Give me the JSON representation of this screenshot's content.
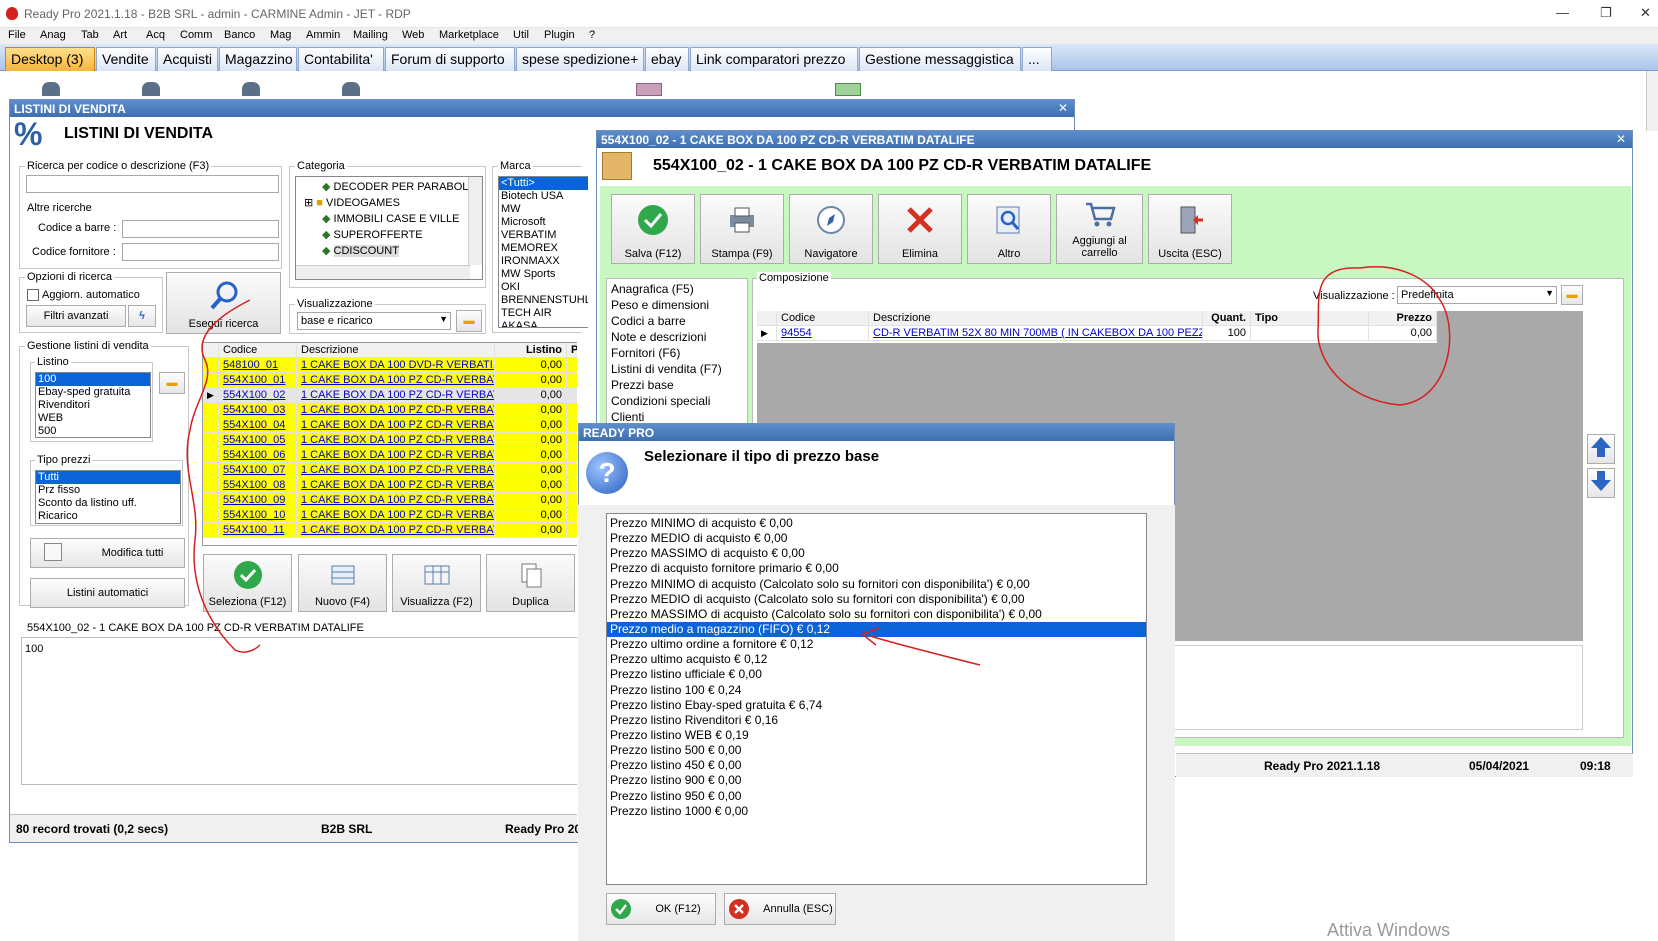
{
  "app": {
    "title": "Ready Pro 2021.1.18 - B2B SRL - admin - CARMINE Admin - JET - RDP",
    "window_controls": [
      "—",
      "❐",
      "✕"
    ]
  },
  "menu": [
    "File",
    "Anag",
    "Tab",
    "Art",
    "Acq",
    "Comm",
    "Banco",
    "Mag",
    "Ammin",
    "Mailing",
    "Web",
    "Marketplace",
    "Util",
    "Plugin",
    "?"
  ],
  "tabs": [
    "Desktop (3)",
    "Vendite",
    "Acquisti",
    "Magazzino",
    "Contabilita'",
    "Forum di supporto",
    "spese spedizione+",
    "ebay",
    "Link comparatori prezzo",
    "Gestione messaggistica",
    "..."
  ],
  "listini": {
    "window_title": "LISTINI DI VENDITA",
    "heading": "LISTINI DI VENDITA",
    "pct_icon": "%",
    "search_label": "Ricerca per codice o descrizione (F3)",
    "search_value": "",
    "altre_label": "Altre ricerche",
    "barcode_label": "Codice a barre :",
    "supplier_code_label": "Codice fornitore :",
    "options_label": "Opzioni di ricerca",
    "auto_update_label": "Aggiorn. automatico",
    "advanced_filters_label": "Filtri avanzati",
    "run_search_label": "Esegui ricerca",
    "category_label": "Categoria",
    "categories": [
      "DECODER PER PARABOLA",
      "VIDEOGAMES",
      "IMMOBILI CASE E VILLE",
      "SUPEROFFERTE",
      "CDISCOUNT"
    ],
    "brand_label": "Marca",
    "brands": [
      "<Tutti>",
      "Biotech USA",
      "MW",
      "Microsoft",
      "VERBATIM",
      "MEMOREX",
      "IRONMAXX",
      "MW Sports",
      "OKI",
      "BRENNENSTUHL",
      "TECH AIR",
      "AKASA"
    ],
    "view_label": "Visualizzazione",
    "view_value": "base e ricarico",
    "gestione_label": "Gestione listini di vendita",
    "listino_label": "Listino",
    "listini": [
      "100",
      "Ebay-sped gratuita",
      "Rivenditori",
      "WEB",
      "500"
    ],
    "tipo_prezzi_label": "Tipo prezzi",
    "tipo_prezzi": [
      "Tutti",
      "Prz fisso",
      "Sconto da listino uff.",
      "Ricarico"
    ],
    "modify_all_label": "Modifica tutti",
    "auto_lists_label": "Listini automatici",
    "grid_headers": [
      "Codice",
      "Descrizione",
      "Listino",
      "P"
    ],
    "rows": [
      {
        "code": "548100_01",
        "desc": "1 CAKE BOX DA 100 DVD-R VERBATI...",
        "price": "0,00"
      },
      {
        "code": "554X100_01",
        "desc": "1 CAKE BOX DA 100 PZ CD-R VERBAT...",
        "price": "0,00"
      },
      {
        "code": "554X100_02",
        "desc": "1 CAKE BOX DA 100 PZ CD-R VERBAT...",
        "price": "0,00"
      },
      {
        "code": "554X100_03",
        "desc": "1 CAKE BOX DA 100 PZ CD-R VERBAT...",
        "price": "0,00"
      },
      {
        "code": "554X100_04",
        "desc": "1 CAKE BOX DA 100 PZ CD-R VERBAT...",
        "price": "0,00"
      },
      {
        "code": "554X100_05",
        "desc": "1 CAKE BOX DA 100 PZ CD-R VERBAT...",
        "price": "0,00"
      },
      {
        "code": "554X100_06",
        "desc": "1 CAKE BOX DA 100 PZ CD-R VERBAT...",
        "price": "0,00"
      },
      {
        "code": "554X100_07",
        "desc": "1 CAKE BOX DA 100 PZ CD-R VERBAT...",
        "price": "0,00"
      },
      {
        "code": "554X100_08",
        "desc": "1 CAKE BOX DA 100 PZ CD-R VERBAT...",
        "price": "0,00"
      },
      {
        "code": "554X100_09",
        "desc": "1 CAKE BOX DA 100 PZ CD-R VERBAT...",
        "price": "0,00"
      },
      {
        "code": "554X100_10",
        "desc": "1 CAKE BOX DA 100 PZ CD-R VERBAT...",
        "price": "0,00"
      },
      {
        "code": "554X100_11",
        "desc": "1 CAKE BOX DA 100 PZ CD-R VERBAT...",
        "price": "0,00"
      }
    ],
    "buttons": [
      "Seleziona (F12)",
      "Nuovo (F4)",
      "Visualizza (F2)",
      "Duplica"
    ],
    "detail_title": "554X100_02 - 1 CAKE BOX DA 100 PZ CD-R VERBATIM DATALIFE",
    "detail_value": "100",
    "status_records": "80 record trovati (0,2 secs)",
    "status_company": "B2B SRL",
    "status_version": "Ready Pro 20"
  },
  "article": {
    "window_title": "554X100_02 - 1 CAKE BOX DA 100 PZ CD-R VERBATIM DATALIFE",
    "heading": "554X100_02 - 1 CAKE BOX DA 100 PZ CD-R VERBATIM DATALIFE",
    "toolbar": [
      "Salva (F12)",
      "Stampa (F9)",
      "Navigatore",
      "Elimina",
      "Altro",
      "Aggiungi al carrello",
      "Uscita (ESC)"
    ],
    "nav": [
      "Anagrafica (F5)",
      "Peso e dimensioni",
      "Codici a barre",
      "Note e descrizioni",
      "Fornitori (F6)",
      "Listini di vendita (F7)",
      "Prezzi base",
      "Condizioni speciali",
      "Clienti"
    ],
    "comp_label": "Composizione",
    "view_label": "Visualizzazione :",
    "view_value": "Predefinita",
    "grid_headers": [
      "Codice",
      "Descrizione",
      "Quant.",
      "Tipo",
      "Prezzo"
    ],
    "row": {
      "code": "94554",
      "desc": "CD-R VERBATIM 52X 80 MIN  700MB ( IN CAKEBOX DA 100  PEZZ...",
      "qty": "100",
      "type": "",
      "price": "0,00"
    },
    "status_version": "Ready Pro 2021.1.18",
    "status_date": "05/04/2021",
    "status_time": "09:18"
  },
  "dialog": {
    "title": "READY PRO",
    "question": "Selezionare il tipo di prezzo base",
    "options": [
      "Prezzo MINIMO di acquisto € 0,00",
      "Prezzo MEDIO di acquisto € 0,00",
      "Prezzo MASSIMO di acquisto € 0,00",
      "Prezzo di acquisto fornitore primario € 0,00",
      "Prezzo MINIMO di acquisto (Calcolato solo su fornitori con disponibilita') € 0,00",
      "Prezzo MEDIO di acquisto (Calcolato solo su fornitori con disponibilita') € 0,00",
      "Prezzo MASSIMO di acquisto (Calcolato solo su fornitori con disponibilita') € 0,00",
      "Prezzo medio a magazzino (FIFO) € 0,12",
      "Prezzo ultimo ordine a fornitore € 0,12",
      "Prezzo ultimo acquisto € 0,12",
      "Prezzo listino ufficiale € 0,00",
      "Prezzo listino 100 € 0,24",
      "Prezzo listino Ebay-sped gratuita € 6,74",
      "Prezzo listino Rivenditori € 0,16",
      "Prezzo listino WEB € 0,19",
      "Prezzo listino 500 € 0,00",
      "Prezzo listino 450 € 0,00",
      "Prezzo listino 900 € 0,00",
      "Prezzo listino 950 € 0,00",
      "Prezzo listino 1000 € 0,00"
    ],
    "selected_index": 7,
    "ok_label": "OK (F12)",
    "cancel_label": "Annulla (ESC)"
  },
  "watermark": "Attiva Windows",
  "colors": {
    "accent": "#0a64d8",
    "title": "#4a7bbd",
    "highlight": "#ffff00",
    "green_panel": "#c9f7c1",
    "annotation": "#d42020"
  }
}
